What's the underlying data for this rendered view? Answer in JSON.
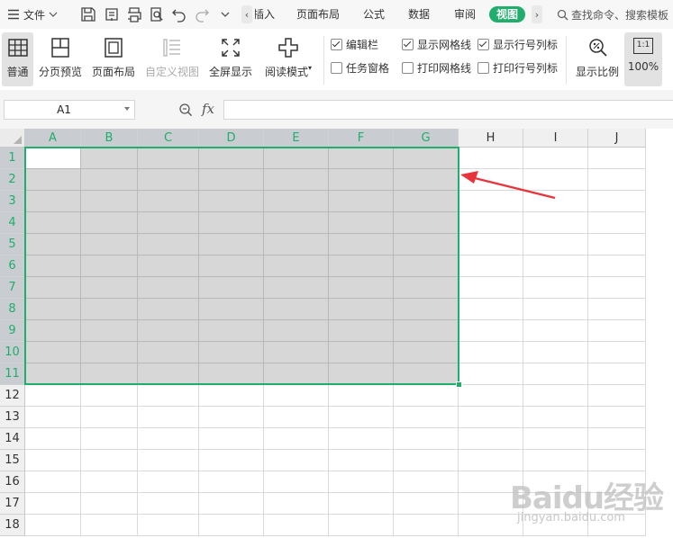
{
  "topbar": {
    "file_label": "文件",
    "tabs": [
      {
        "label": "插入"
      },
      {
        "label": "页面布局"
      },
      {
        "label": "公式"
      },
      {
        "label": "数据"
      },
      {
        "label": "审阅"
      },
      {
        "label": "视图"
      }
    ],
    "active_tab": "视图",
    "search_label": "查找命令、搜索模板"
  },
  "ribbon": {
    "buttons": [
      {
        "label": "普通",
        "pressed": true
      },
      {
        "label": "分页预览"
      },
      {
        "label": "页面布局"
      },
      {
        "label": "自定义视图",
        "disabled": true
      },
      {
        "label": "全屏显示"
      },
      {
        "label": "阅读模式"
      }
    ],
    "checkboxes": [
      {
        "label": "编辑栏",
        "checked": true
      },
      {
        "label": "显示网格线",
        "checked": true
      },
      {
        "label": "显示行号列标",
        "checked": true
      },
      {
        "label": "任务窗格",
        "checked": false
      },
      {
        "label": "打印网格线",
        "checked": false
      },
      {
        "label": "打印行号列标",
        "checked": false
      }
    ],
    "zoom_button_label": "显示比例",
    "zoom_icon_text": "1:1",
    "zoom_value": "100%"
  },
  "formula_bar": {
    "name_box": "A1",
    "fx_label": "fx",
    "formula": ""
  },
  "sheet": {
    "columns": [
      "A",
      "B",
      "C",
      "D",
      "E",
      "F",
      "G",
      "H",
      "I",
      "J"
    ],
    "rows": [
      "1",
      "2",
      "3",
      "4",
      "5",
      "6",
      "7",
      "8",
      "9",
      "10",
      "11",
      "12",
      "13",
      "14",
      "15",
      "16",
      "17",
      "18"
    ],
    "selection": "A1:G11",
    "active_cell": "A1"
  },
  "watermark": {
    "brand": "Baidu经验",
    "url": "jingyan.baidu.com"
  },
  "colors": {
    "accent_green": "#1fae6b",
    "annotation_red": "#e8353b",
    "selection_fill": "#d7d7d7"
  }
}
